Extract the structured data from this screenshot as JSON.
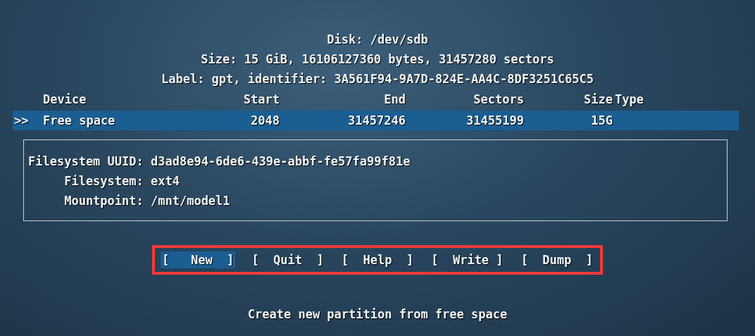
{
  "header": {
    "title": "Disk: /dev/sdb",
    "size_line": "Size: 15 GiB, 16106127360 bytes, 31457280 sectors",
    "label_line": "Label: gpt, identifier: 3A561F94-9A7D-824E-AA4C-8DF3251C65C5"
  },
  "table": {
    "columns": [
      "Device",
      "Start",
      "End",
      "Sectors",
      "Size",
      "Type"
    ],
    "rows": [
      {
        "marker": ">>",
        "cells": [
          "Free space",
          "2048",
          "31457246",
          "31455199",
          "15G"
        ],
        "selected": true
      }
    ]
  },
  "details": [
    "Filesystem UUID: d3ad8e94-6de6-439e-abbf-fe57fa99f81e",
    "     Filesystem: ext4",
    "     Mountpoint: /mnt/model1"
  ],
  "buttons": [
    {
      "label": "[   New  ]",
      "selected": true
    },
    {
      "label": "[  Quit  ]",
      "selected": false
    },
    {
      "label": "[  Help  ]",
      "selected": false
    },
    {
      "label": "[  Write ]",
      "selected": false
    },
    {
      "label": "[  Dump  ]",
      "selected": false
    }
  ],
  "status": "Create new partition from free space"
}
